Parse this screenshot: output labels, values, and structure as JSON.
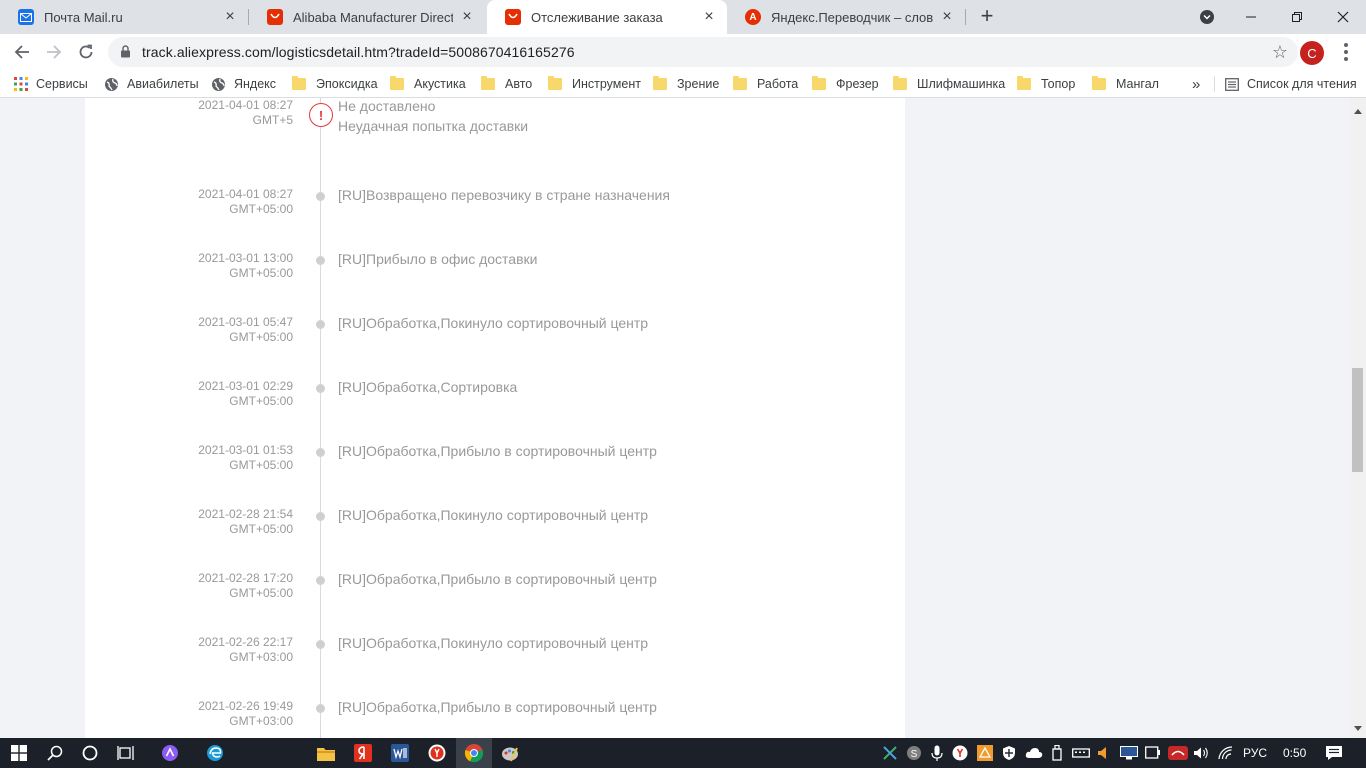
{
  "browser": {
    "tabs": [
      {
        "title": "Почта Mail.ru",
        "favicon": "mail-icon",
        "color": "#1a73e8"
      },
      {
        "title": "Alibaba Manufacturer Directory - ",
        "favicon": "aliexpress-icon",
        "color": "#e62e04"
      },
      {
        "title": "Отслеживание заказа",
        "favicon": "aliexpress-icon",
        "color": "#e62e04"
      },
      {
        "title": "Яндекс.Переводчик – словарь и ",
        "favicon": "yandex-translate-icon",
        "color": "#e62e04"
      }
    ],
    "url": "track.aliexpress.com/logisticsdetail.htm?tradeId=5008670416165276",
    "profile_initial": "C",
    "bookmarks": [
      {
        "label": "Сервисы",
        "icon": "apps-grid-icon"
      },
      {
        "label": "Авиабилеты",
        "icon": "globe-icon"
      },
      {
        "label": "Яндекс",
        "icon": "globe-icon"
      },
      {
        "label": "Эпоксидка",
        "icon": "folder-icon"
      },
      {
        "label": "Акустика",
        "icon": "folder-icon"
      },
      {
        "label": "Авто",
        "icon": "folder-icon"
      },
      {
        "label": "Инструмент",
        "icon": "folder-icon"
      },
      {
        "label": "Зрение",
        "icon": "folder-icon"
      },
      {
        "label": "Работа",
        "icon": "folder-icon"
      },
      {
        "label": "Фрезер",
        "icon": "folder-icon"
      },
      {
        "label": "Шлифмашинка",
        "icon": "folder-icon"
      },
      {
        "label": "Топор",
        "icon": "folder-icon"
      },
      {
        "label": "Мангал",
        "icon": "folder-icon"
      }
    ],
    "more_bookmarks": "»",
    "reading_list": "Список для чтения"
  },
  "tracking": {
    "events": [
      {
        "date": "2021-04-01 08:27",
        "tz": "GMT+5",
        "status": "Не доставлено",
        "detail": "Неудачная попытка доставки",
        "alert": "!"
      },
      {
        "date": "2021-04-01 08:27",
        "tz": "GMT+05:00",
        "status": "[RU]Возвращено перевозчику в стране назначения"
      },
      {
        "date": "2021-03-01 13:00",
        "tz": "GMT+05:00",
        "status": "[RU]Прибыло в офис доставки"
      },
      {
        "date": "2021-03-01 05:47",
        "tz": "GMT+05:00",
        "status": "[RU]Обработка,Покинуло сортировочный центр"
      },
      {
        "date": "2021-03-01 02:29",
        "tz": "GMT+05:00",
        "status": "[RU]Обработка,Сортировка"
      },
      {
        "date": "2021-03-01 01:53",
        "tz": "GMT+05:00",
        "status": "[RU]Обработка,Прибыло в сортировочный центр"
      },
      {
        "date": "2021-02-28 21:54",
        "tz": "GMT+05:00",
        "status": "[RU]Обработка,Покинуло сортировочный центр"
      },
      {
        "date": "2021-02-28 17:20",
        "tz": "GMT+05:00",
        "status": "[RU]Обработка,Прибыло в сортировочный центр"
      },
      {
        "date": "2021-02-26 22:17",
        "tz": "GMT+03:00",
        "status": "[RU]Обработка,Покинуло сортировочный центр"
      },
      {
        "date": "2021-02-26 19:49",
        "tz": "GMT+03:00",
        "status": "[RU]Обработка,Прибыло в сортировочный центр"
      }
    ]
  },
  "taskbar": {
    "language": "РУС",
    "time": "0:50"
  },
  "colors": {
    "alert": "#e0393e",
    "tabstrip": "#dee1e6",
    "taskbar": "#1b2029"
  }
}
